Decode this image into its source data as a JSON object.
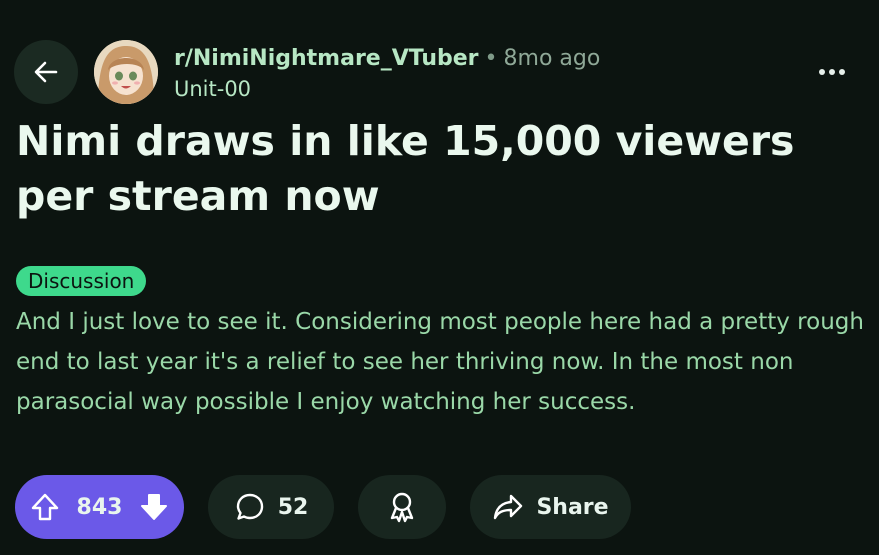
{
  "post": {
    "subreddit": "r/NimiNightmare_VTuber",
    "separator": "•",
    "time_ago": "8mo ago",
    "author": "Unit-00",
    "title": "Nimi draws in like 15,000 viewers per stream now",
    "flair": "Discussion",
    "body": "And I just love to see it. Considering most people here had a pretty rough end to last year it's a relief to see her thriving now. In the most non parasocial way possible I enjoy watching her success."
  },
  "actions": {
    "vote_count": "843",
    "comment_count": "52",
    "share_label": "Share"
  },
  "icons": {
    "back": "arrow-left-icon",
    "more": "more-horizontal-icon",
    "upvote": "arrow-up-icon",
    "downvote": "arrow-down-icon",
    "comment": "chat-bubble-icon",
    "award": "award-icon",
    "share": "share-arrow-icon"
  },
  "colors": {
    "background": "#0c1410",
    "flair": "#3ed98c",
    "vote_button": "#6b59e8",
    "body_text": "#9ad8a8"
  }
}
